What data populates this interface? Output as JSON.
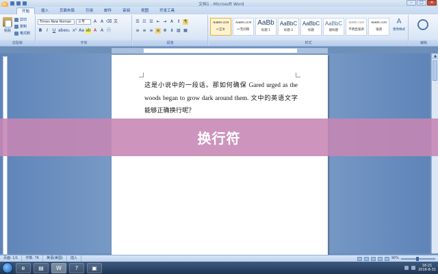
{
  "window": {
    "title": "文档1 - Microsoft Word",
    "controls": [
      "–",
      "□",
      "×"
    ]
  },
  "tabs": [
    "开始",
    "插入",
    "页面布局",
    "引用",
    "邮件",
    "审阅",
    "视图",
    "开发工具"
  ],
  "ribbon": {
    "clipboard": {
      "label": "剪贴板",
      "paste": "粘贴",
      "cut": "剪切",
      "copy": "复制",
      "format_painter": "格式刷"
    },
    "font": {
      "label": "字体",
      "font_name": "Times New Roman",
      "font_size": "三号",
      "bold": "B",
      "italic": "I",
      "underline": "U"
    },
    "paragraph": {
      "label": "段落"
    },
    "styles": {
      "label": "样式",
      "items": [
        {
          "preview": "AaBbCcDd",
          "name": "↵正文",
          "big": false,
          "selected": true
        },
        {
          "preview": "AaBbCcDd",
          "name": "↵无间隔",
          "big": false,
          "selected": false
        },
        {
          "preview": "AaBb",
          "name": "标题 1",
          "big": true,
          "selected": false
        },
        {
          "preview": "AaBbC",
          "name": "标题 2",
          "big": true,
          "selected": false
        },
        {
          "preview": "AaBbC",
          "name": "标题",
          "big": true,
          "selected": false
        },
        {
          "preview": "AaBbC",
          "name": "副标题",
          "big": true,
          "selected": false
        },
        {
          "preview": "AaBbCcDd",
          "name": "不明显强调",
          "big": false,
          "selected": false
        },
        {
          "preview": "AaBbCcDd",
          "name": "强调",
          "big": false,
          "selected": false
        }
      ],
      "change_styles": "更改样式"
    },
    "editing": {
      "label": "编辑"
    }
  },
  "document": {
    "text": "这是小说中的一段话。那如何确保 Gared urged as the woods began to grow dark around them. 文中的英语文字能够正确换行呢？"
  },
  "banner": {
    "text": "换行符"
  },
  "statusbar": {
    "page": "页面: 1/1",
    "words": "字数: 76",
    "language": "英语(美国)",
    "mode": "插入",
    "zoom": "90%"
  },
  "taskbar": {
    "apps": [
      "e",
      "▤",
      "W",
      "?",
      "▣"
    ],
    "time": "16:21",
    "date": "2016-8-31"
  }
}
